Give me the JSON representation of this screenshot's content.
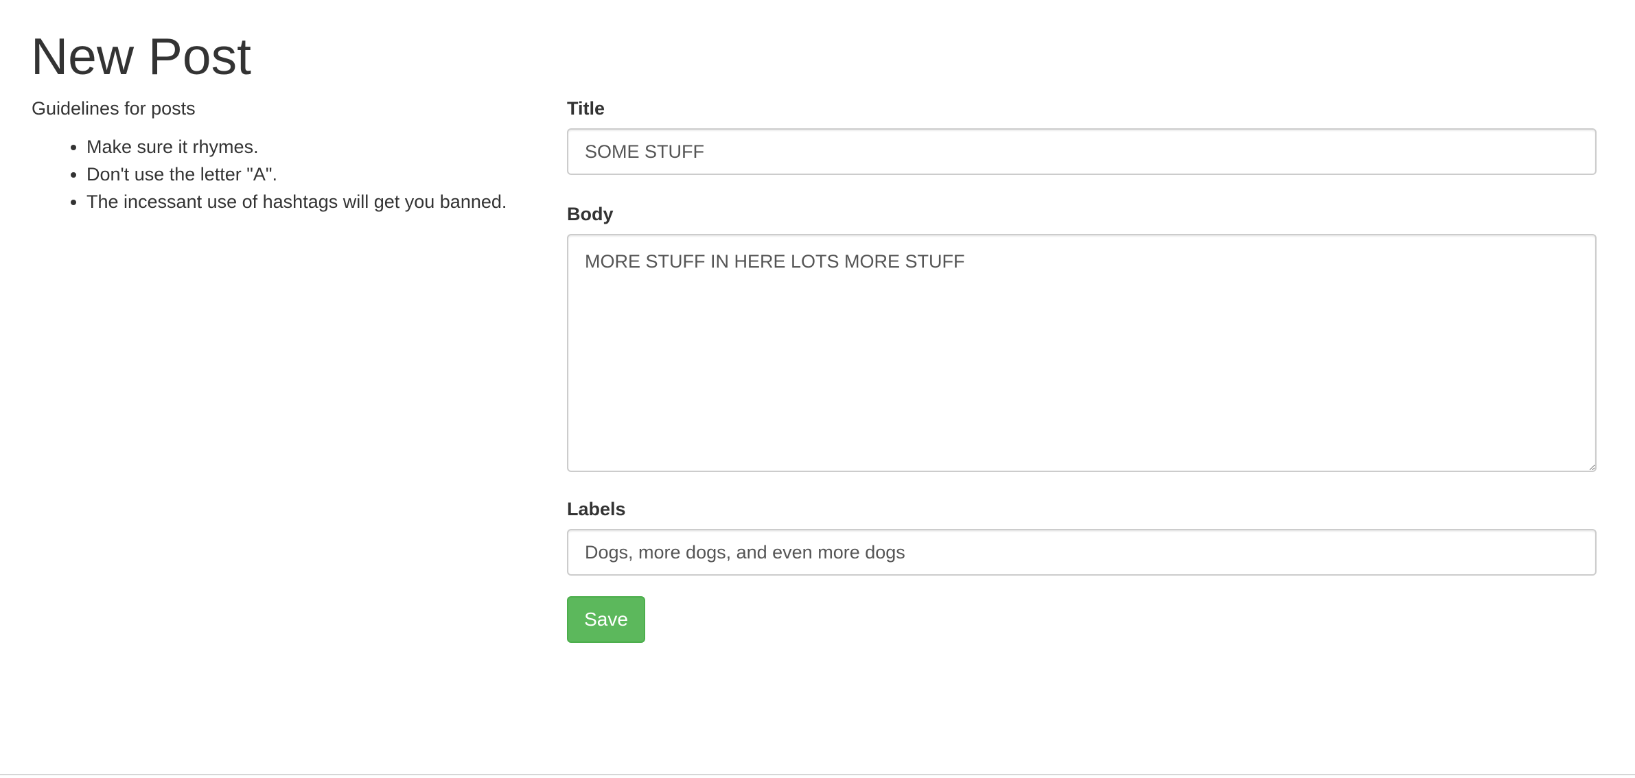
{
  "page": {
    "title": "New Post"
  },
  "guidelines": {
    "heading": "Guidelines for posts",
    "items": [
      "Make sure it rhymes.",
      "Don't use the letter \"A\".",
      "The incessant use of hashtags will get you banned."
    ]
  },
  "form": {
    "title": {
      "label": "Title",
      "value": "SOME STUFF"
    },
    "body": {
      "label": "Body",
      "value": "MORE STUFF IN HERE LOTS MORE STUFF"
    },
    "labels": {
      "label": "Labels",
      "value": "Dogs, more dogs, and even more dogs"
    },
    "save_label": "Save"
  },
  "colors": {
    "text": "#333333",
    "input_text": "#555555",
    "input_border": "#cccccc",
    "save_button": "#5cb85c",
    "save_button_border": "#4cae4c"
  }
}
